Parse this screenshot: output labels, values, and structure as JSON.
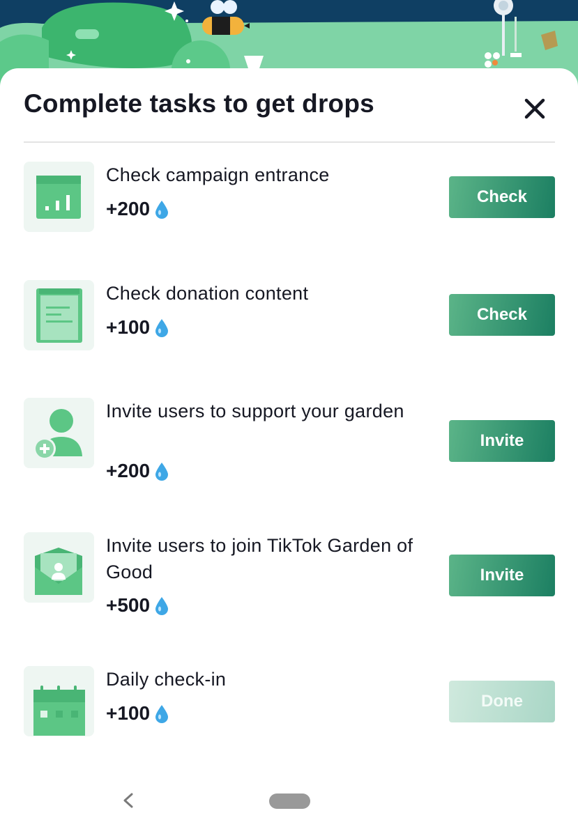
{
  "sheet": {
    "title": "Complete tasks to get drops",
    "close_icon": "close-icon"
  },
  "tasks": [
    {
      "title": "Check campaign entrance",
      "points": "+200",
      "button": "Check",
      "icon": "bar-chart-icon",
      "state": "active"
    },
    {
      "title": "Check donation content",
      "points": "+100",
      "button": "Check",
      "icon": "clipboard-icon",
      "state": "active"
    },
    {
      "title": "Invite users to support your garden",
      "points": "+200",
      "button": "Invite",
      "icon": "add-user-icon",
      "state": "active"
    },
    {
      "title": "Invite users to join TikTok Garden of Good",
      "points": "+500",
      "button": "Invite",
      "icon": "invite-envelope-icon",
      "state": "active"
    },
    {
      "title": "Daily check-in",
      "points": "+100",
      "button": "Done",
      "icon": "calendar-icon",
      "state": "done"
    }
  ],
  "colors": {
    "accent_start": "#5bb488",
    "accent_end": "#1c7f62",
    "icon_green": "#5cc685",
    "drop_blue": "#3ea7e6",
    "banner_navy": "#0f3f63"
  },
  "nav": {
    "back_icon": "back-chevron-icon",
    "home_icon": "home-pill-icon"
  }
}
